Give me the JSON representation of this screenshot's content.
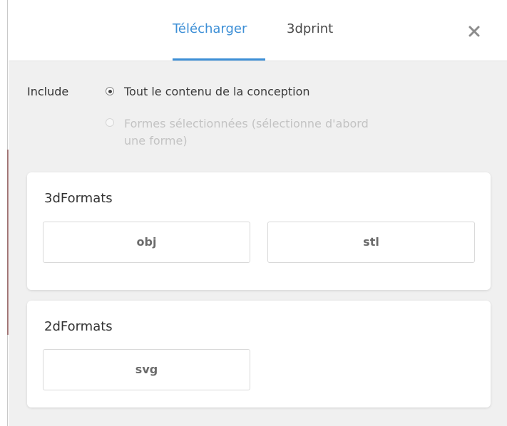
{
  "header": {
    "tabs": [
      {
        "label": "Télécharger",
        "active": true
      },
      {
        "label": "3dprint",
        "active": false
      }
    ],
    "close_icon": "close-icon"
  },
  "include": {
    "label": "Include",
    "options": [
      {
        "label": "Tout le contenu de la conception",
        "selected": true,
        "disabled": false
      },
      {
        "label": "Formes sélectionnées (sélectionne d'abord une forme)",
        "selected": false,
        "disabled": true
      }
    ]
  },
  "sections": [
    {
      "title": "3dFormats",
      "buttons": [
        "obj",
        "stl"
      ]
    },
    {
      "title": "2dFormats",
      "buttons": [
        "svg"
      ]
    }
  ],
  "colors": {
    "accent": "#3d8fd6",
    "panel_background": "#f0f0f0",
    "card_background": "#ffffff"
  }
}
